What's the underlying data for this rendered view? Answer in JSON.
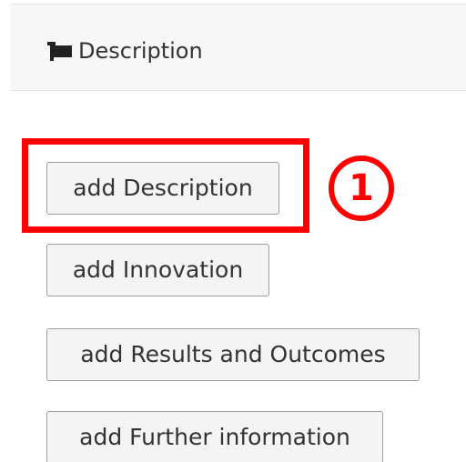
{
  "header": {
    "icon": "flag-icon",
    "title": "Description"
  },
  "buttons": {
    "add_description": "add Description",
    "add_innovation": "add Innovation",
    "add_results": "add Results and Outcomes",
    "add_further": "add Further information"
  },
  "annotation": {
    "callout_number": "1",
    "color": "#ff0000"
  }
}
